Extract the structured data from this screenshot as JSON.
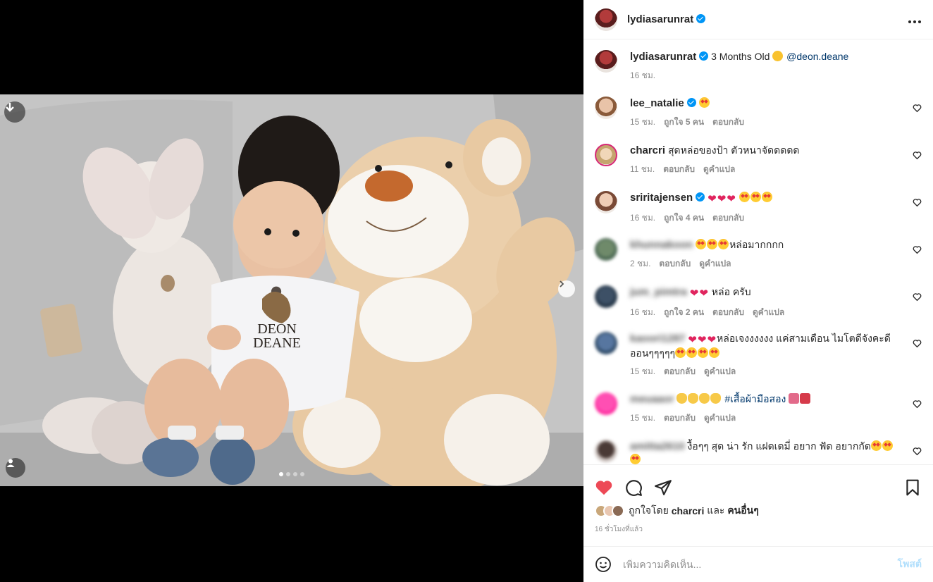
{
  "post": {
    "author": "lydiasarunrat",
    "author_verified": true,
    "more_icon": "more-horizontal-icon",
    "carousel": {
      "slides": 4,
      "active_slide": 1
    },
    "photo_text": "DEON DEANE"
  },
  "caption": {
    "username": "lydiasarunrat",
    "text": "3 Months Old",
    "mention": "@deon.deane",
    "time": "16 ชม."
  },
  "comments": [
    {
      "username": "lee_natalie",
      "verified": true,
      "text": "",
      "time": "15 ชม.",
      "likes": "ถูกใจ 5 คน",
      "reply": "ตอบกลับ",
      "translate": ""
    },
    {
      "username": "charcri",
      "verified": false,
      "text": "สุดหล่อของป้า ตัวหนาจัดดดดด",
      "time": "11 ชม.",
      "likes": "",
      "reply": "ตอบกลับ",
      "translate": "ดูคำแปล"
    },
    {
      "username": "sriritajensen",
      "verified": true,
      "text": "",
      "time": "16 ชม.",
      "likes": "ถูกใจ 4 คน",
      "reply": "ตอบกลับ",
      "translate": ""
    },
    {
      "username": "khunnakoon",
      "verified": false,
      "text": "หล่อมากกกก",
      "time": "2 ชม.",
      "likes": "",
      "reply": "ตอบกลับ",
      "translate": "ดูคำแปล"
    },
    {
      "username": "jum_pimtra",
      "verified": false,
      "text": "หล่อ ครับ",
      "time": "16 ชม.",
      "likes": "ถูกใจ 2 คน",
      "reply": "ตอบกลับ",
      "translate": "ดูคำแปล"
    },
    {
      "username": "kaoori1287",
      "verified": false,
      "text": "หล่อเจงงงงงง แค่สามเดือน ไมโตดีจังคะดี",
      "text2": "ออนๆๆๆๆๆ",
      "time": "15 ชม.",
      "likes": "",
      "reply": "ตอบกลับ",
      "translate": "ดูคำแปล"
    },
    {
      "username": "meuaaor",
      "verified": false,
      "text": "",
      "hashtag": "#เสื้อผ้ามือสอง",
      "time": "15 ชม.",
      "likes": "",
      "reply": "ตอบกลับ",
      "translate": "ดูคำแปล"
    },
    {
      "username": "amitta2610",
      "verified": false,
      "text": "งื้อๆๆ สุด น่า รัก แฝดเดมี่ อยาก ฟัด อยากกัด",
      "time": "",
      "likes": "",
      "reply": "",
      "translate": ""
    }
  ],
  "actions": {
    "liked": true,
    "liked_by_prefix": "ถูกใจโดย",
    "liked_by_user": "charcri",
    "liked_by_and": "และ",
    "liked_by_others": "คนอื่นๆ",
    "timestamp": "16 ชั่วโมงที่แล้ว"
  },
  "comment_box": {
    "placeholder": "เพิ่มความคิดเห็น...",
    "post_label": "โพสต์"
  },
  "colors": {
    "like_red": "#ed4956",
    "link_blue": "#00376b",
    "verified_blue": "#0095f6",
    "post_disabled": "#b2dffc"
  }
}
